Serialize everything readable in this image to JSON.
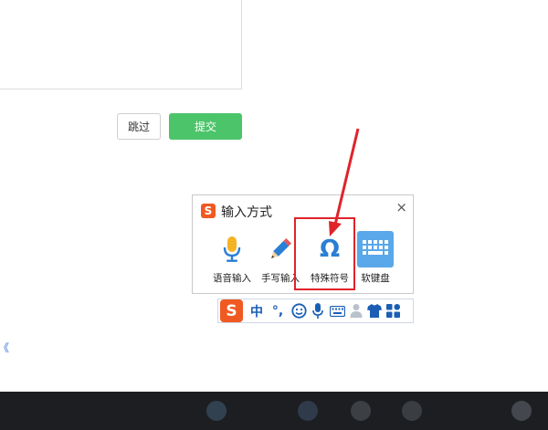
{
  "form": {
    "skip_label": "跳过",
    "submit_label": "提交",
    "edge_glyph": "《"
  },
  "ime_panel": {
    "logo_letter": "S",
    "title": "输入方式",
    "close_glyph": "×",
    "options": [
      {
        "label": "语音输入",
        "icon": "microphone-icon"
      },
      {
        "label": "手写输入",
        "icon": "pencil-icon"
      },
      {
        "label": "特殊符号",
        "icon": "omega-icon",
        "glyph": "Ω"
      },
      {
        "label": "软键盘",
        "icon": "keyboard-icon"
      }
    ]
  },
  "ime_toolbar": {
    "logo_letter": "S",
    "mode_label": "中",
    "punct_label": "°,",
    "items": [
      "emoji-icon",
      "microphone-icon",
      "keyboard-icon",
      "user-icon",
      "shirt-icon",
      "grid-icon"
    ]
  },
  "colors": {
    "submit_green": "#4cc46a",
    "sogou_orange": "#f05a22",
    "highlight_red": "#e0232b",
    "icon_blue": "#2a7fd4",
    "taskbar": "#1c1e21"
  }
}
